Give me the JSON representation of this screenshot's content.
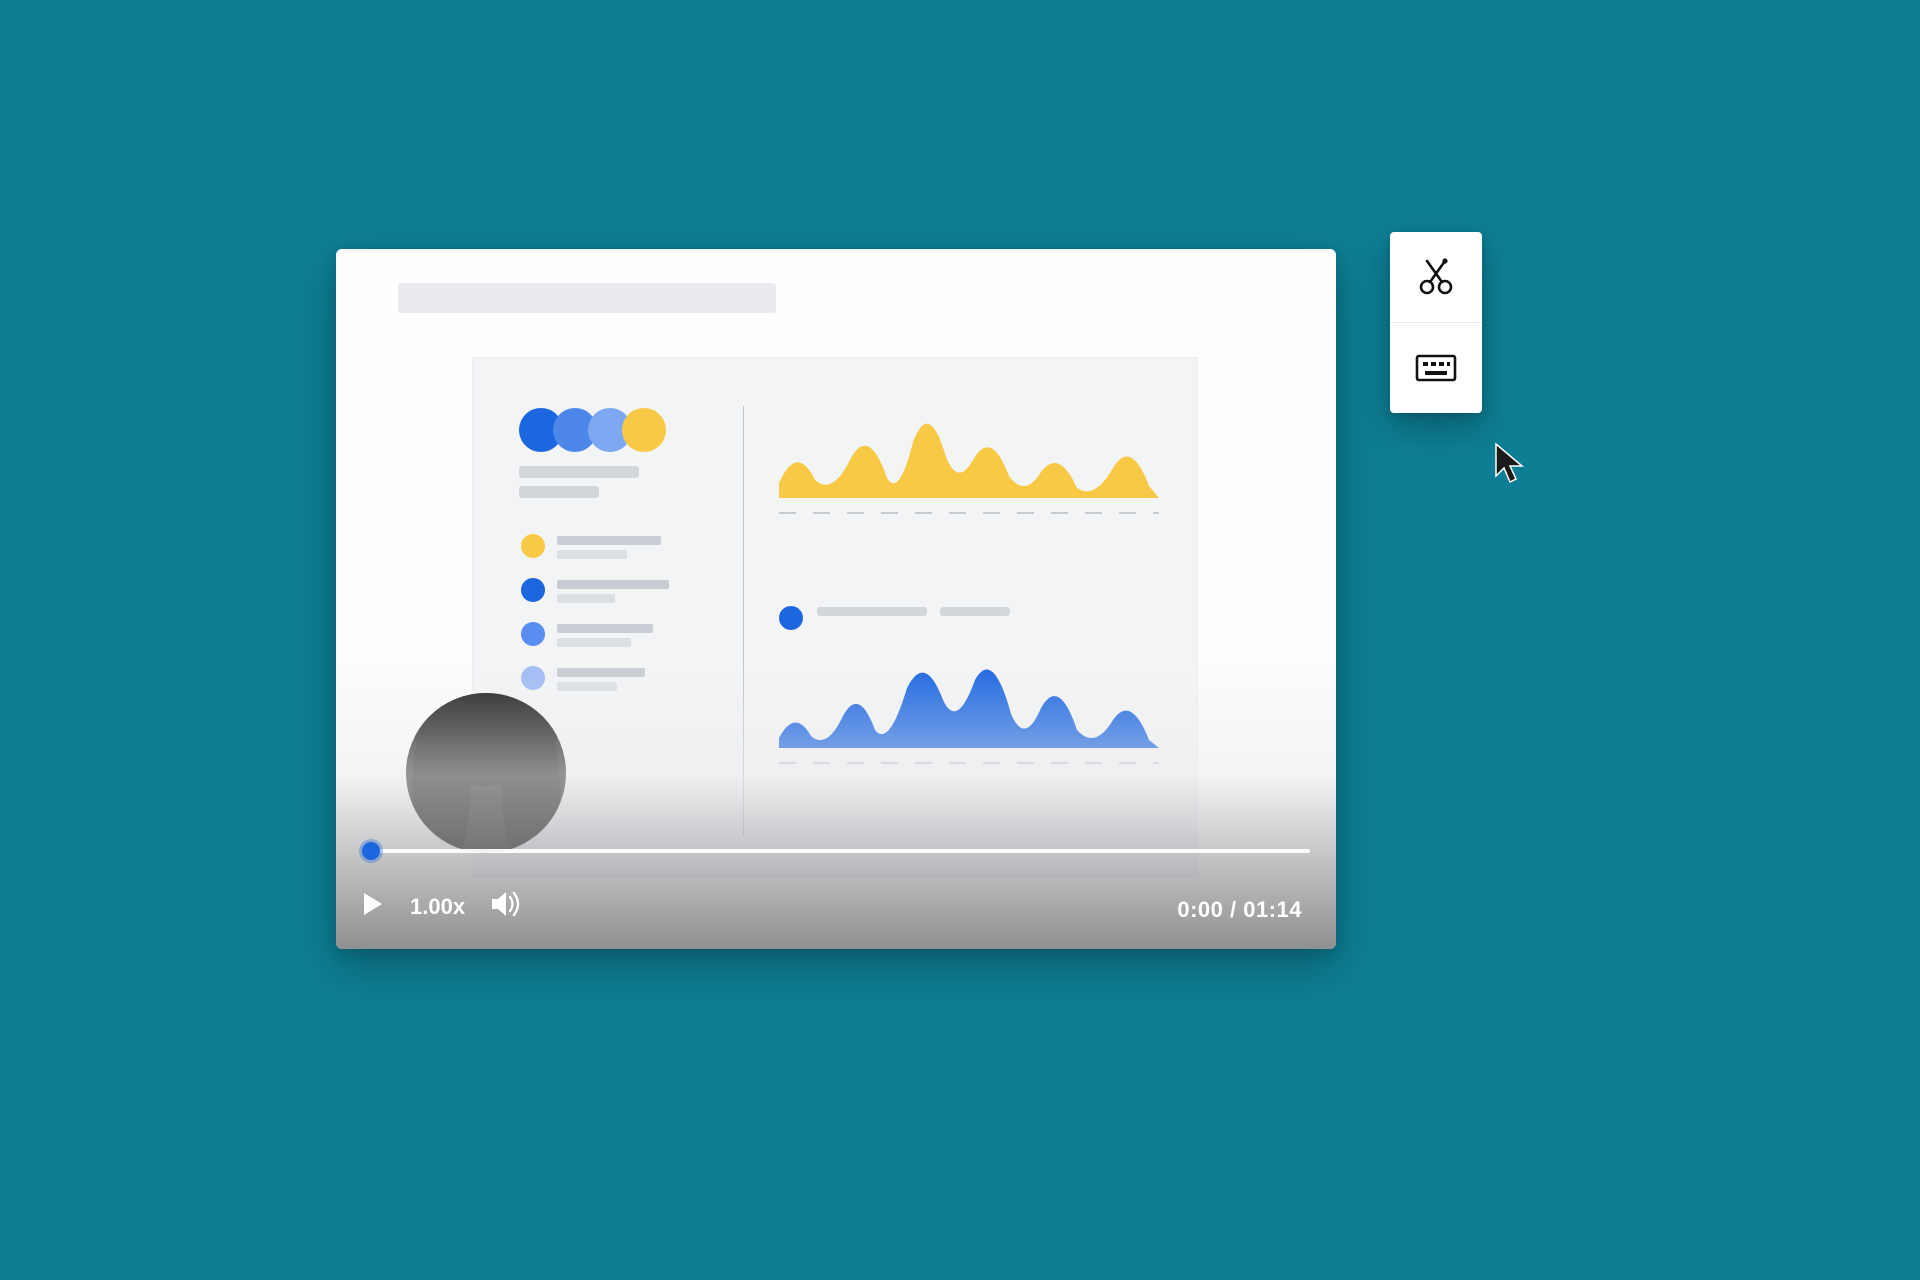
{
  "colors": {
    "background": "#0e7e94",
    "accent_blue": "#1c66e0",
    "accent_yellow": "#f7c944"
  },
  "player": {
    "playback_speed_label": "1.00x",
    "time_display": "0:00 / 01:14",
    "progress_fraction": 0.0
  },
  "tool_panel": {
    "trim_tool_name": "scissors-icon",
    "captions_tool_name": "keyboard-icon"
  },
  "chart_data": [
    {
      "type": "area",
      "title": "",
      "x": [
        0,
        1,
        2,
        3,
        4,
        5,
        6,
        7,
        8,
        9,
        10,
        11,
        12
      ],
      "values": [
        10,
        28,
        12,
        36,
        14,
        58,
        22,
        34,
        10,
        22,
        8,
        20,
        6
      ],
      "ylim": [
        0,
        60
      ],
      "series_color": "#f7c944"
    },
    {
      "type": "area",
      "title": "",
      "x": [
        0,
        1,
        2,
        3,
        4,
        5,
        6,
        7,
        8,
        9,
        10,
        11,
        12
      ],
      "values": [
        6,
        24,
        10,
        22,
        44,
        30,
        52,
        26,
        14,
        30,
        10,
        18,
        6
      ],
      "ylim": [
        0,
        60
      ],
      "series_color": "#1c66e0"
    }
  ]
}
